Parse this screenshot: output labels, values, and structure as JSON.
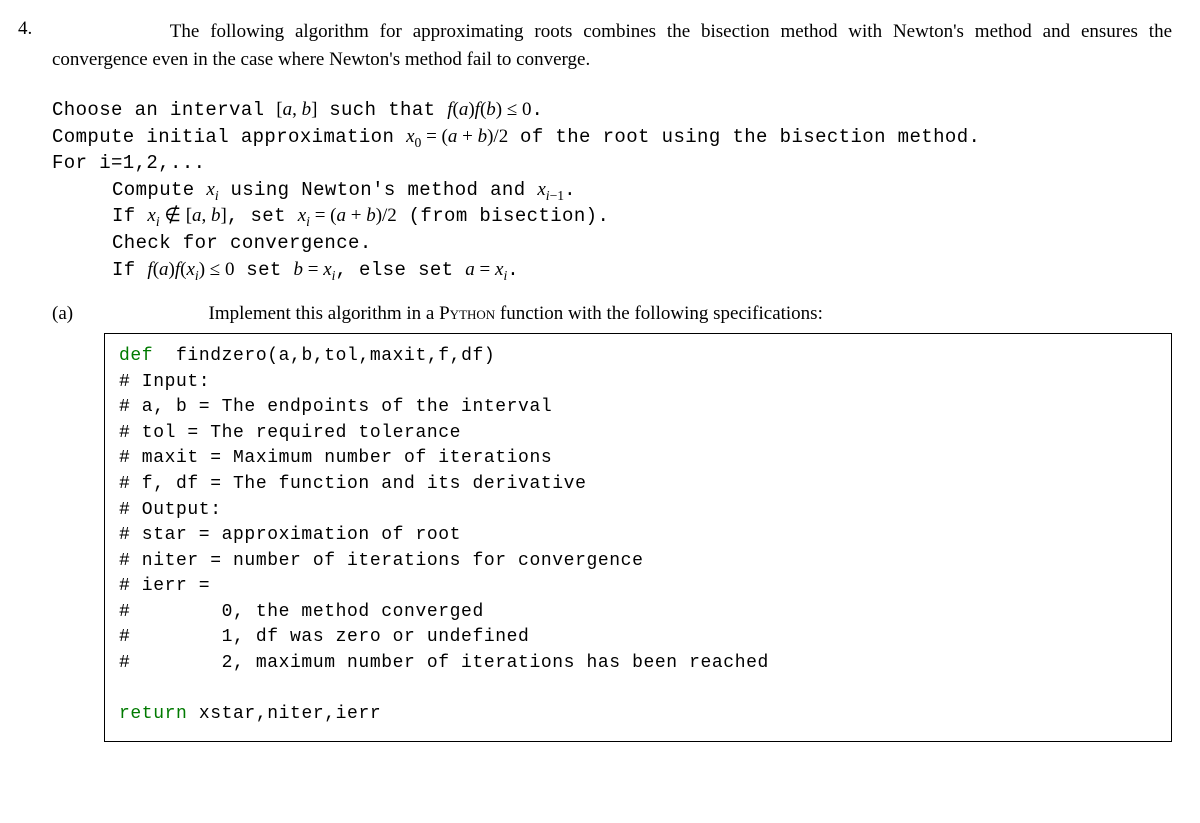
{
  "problem": {
    "number": "4.",
    "intro": "The following algorithm for approximating roots combines the bisection method with Newton's method and ensures the convergence even in the case where Newton's method fail to converge."
  },
  "algo": {
    "line1_pre": "Choose an interval ",
    "line1_math": "[a, b]",
    "line1_mid": " such that ",
    "line1_fab": "f(a)f(b) ≤ 0",
    "line1_end": ".",
    "line2_pre": "Compute initial approximation ",
    "line2_x0eq": "x",
    "line2_eq": " = (a + b)/2",
    "line2_post": " of the root using the bisection method.",
    "line3": "For i=1,2,...",
    "line4_pre": "Compute ",
    "line4_mid": " using Newton's method and ",
    "line4_end": ".",
    "line5_pre": "If ",
    "line5_notin": " ∉ [a, b]",
    "line5_set": ", set ",
    "line5_eq": " = (a + b)/2",
    "line5_post": " (from bisection).",
    "line6": "Check for convergence.",
    "line7_pre": "If ",
    "line7_faxi": " ≤ 0",
    "line7_setb": " set ",
    "line7_beq": "b = ",
    "line7_else": ", else set ",
    "line7_aeq": "a = ",
    "line7_end": "."
  },
  "part_a": {
    "label": "(a)",
    "text_pre": "Implement this algorithm in a ",
    "python": "Python",
    "text_post": " function with the following specifications:"
  },
  "code": {
    "l1a": "def",
    "l1b": "  findzero(a,b,tol,maxit,f,df)",
    "l2": "# Input:",
    "l3": "# a, b = The endpoints of the interval",
    "l4": "# tol = The required tolerance",
    "l5": "# maxit = Maximum number of iterations",
    "l6": "# f, df = The function and its derivative",
    "l7": "# Output:",
    "l8": "# star = approximation of root",
    "l9": "# niter = number of iterations for convergence",
    "l10": "# ierr =",
    "l11": "#        0, the method converged",
    "l12": "#        1, df was zero or undefined",
    "l13": "#        2, maximum number of iterations has been reached",
    "l14": "",
    "l15a": "return",
    "l15b": " xstar,niter,ierr"
  }
}
